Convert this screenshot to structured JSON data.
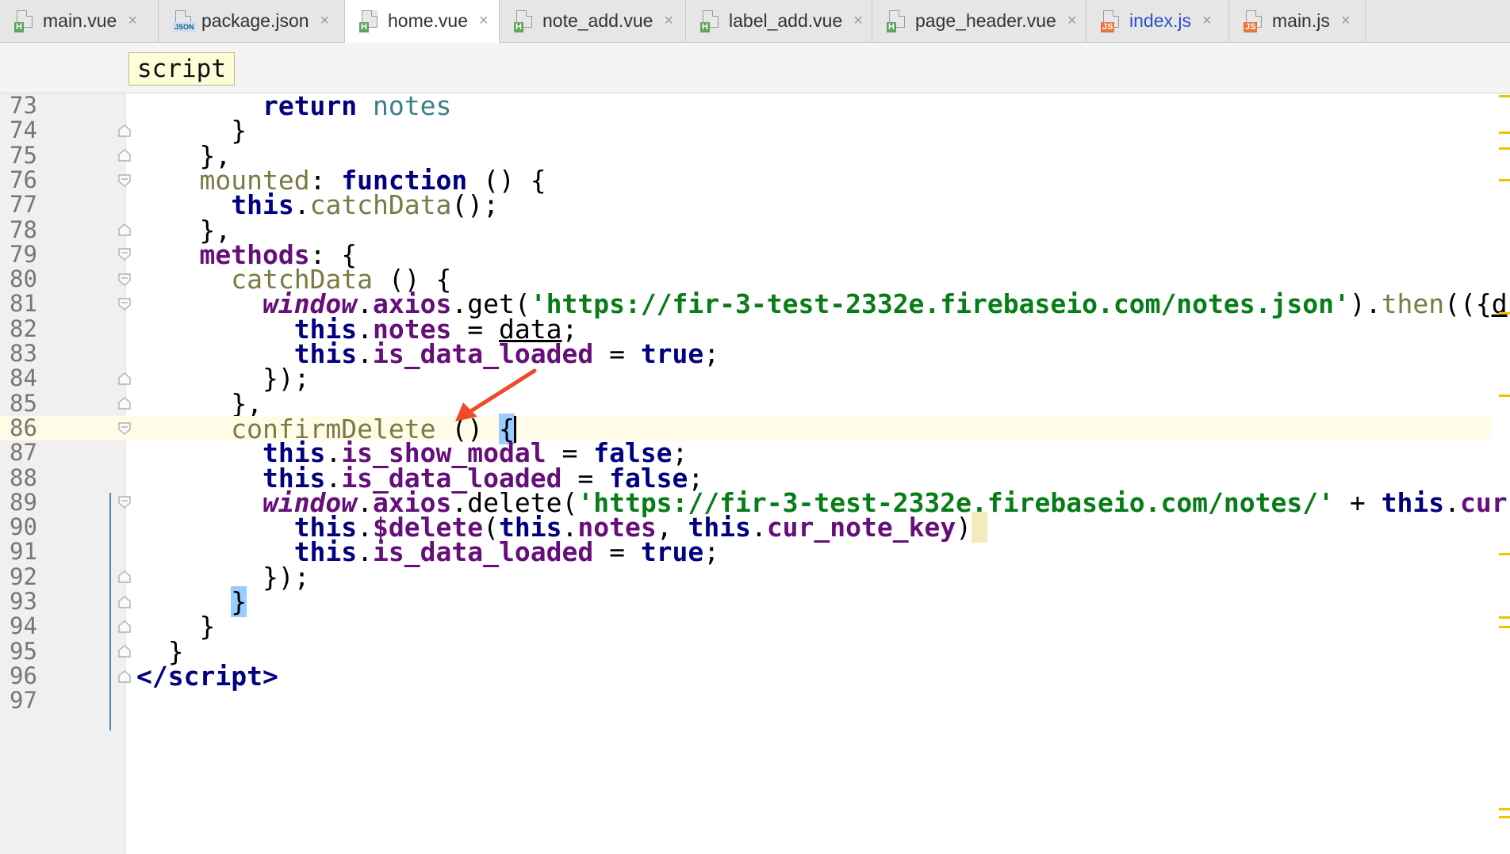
{
  "tabs": [
    {
      "label": "main.vue",
      "type": "vue",
      "badge": "H",
      "active": false
    },
    {
      "label": "package.json",
      "type": "json",
      "badge": "JSON",
      "active": false
    },
    {
      "label": "home.vue",
      "type": "vue",
      "badge": "H",
      "active": true
    },
    {
      "label": "note_add.vue",
      "type": "vue",
      "badge": "H",
      "active": false
    },
    {
      "label": "label_add.vue",
      "type": "vue",
      "badge": "H",
      "active": false
    },
    {
      "label": "page_header.vue",
      "type": "vue",
      "badge": "H",
      "active": false
    },
    {
      "label": "index.js",
      "type": "js",
      "badge": "JS",
      "active": false,
      "highlighted": true
    },
    {
      "label": "main.js",
      "type": "js",
      "badge": "JS",
      "active": false
    }
  ],
  "tab_close_glyph": "×",
  "breadcrumb": {
    "label": "script"
  },
  "editor": {
    "current_line": 86,
    "lines": [
      {
        "num": "73",
        "html": "        <span class=\"kw\">return</span> <span class=\"ref\">notes</span>"
      },
      {
        "num": "74",
        "html": "      }"
      },
      {
        "num": "75",
        "html": "    },"
      },
      {
        "num": "76",
        "html": "    <span class=\"fn\">mounted</span>: <span class=\"kw\">function</span> () {"
      },
      {
        "num": "77",
        "html": "      <span class=\"kw\">this</span>.<span class=\"fn\">catchData</span>();"
      },
      {
        "num": "78",
        "html": "    },"
      },
      {
        "num": "79",
        "html": "    <span class=\"prop\">methods</span>: {"
      },
      {
        "num": "80",
        "html": "      <span class=\"fn\">catchData</span> () {"
      },
      {
        "num": "81",
        "html": "        <span class=\"glob\">window</span>.<span class=\"prop\">axios</span>.get(<span class=\"str\">'https://fir-3-test-2332e.firebaseio.com/notes.json'</span>).<span class=\"fn\">then</span>(({<span class=\"ul\">d</span>"
      },
      {
        "num": "82",
        "html": "          <span class=\"kw\">this</span>.<span class=\"prop\">notes</span> = <span class=\"ul\">data</span>;"
      },
      {
        "num": "83",
        "html": "          <span class=\"kw\">this</span>.<span class=\"prop\">is_data_loaded</span> = <span class=\"kw\">true</span>;"
      },
      {
        "num": "84",
        "html": "        });"
      },
      {
        "num": "85",
        "html": "      },"
      },
      {
        "num": "86",
        "html": "      <span class=\"fn\">confirmDelete</span> () <span class=\"bm\">{</span><span class=\"caret\"></span>"
      },
      {
        "num": "87",
        "html": "        <span class=\"kw\">this</span>.<span class=\"prop\">is_show_modal</span> = <span class=\"kw\">false</span>;"
      },
      {
        "num": "88",
        "html": "        <span class=\"kw\">this</span>.<span class=\"prop\">is_data_loaded</span> = <span class=\"kw\">false</span>;"
      },
      {
        "num": "89",
        "html": "        <span class=\"glob\">window</span>.<span class=\"prop\">axios</span>.delete(<span class=\"str\">'https://fir-3-test-2332e.firebaseio.com/notes/'</span> + <span class=\"kw\">this</span>.<span class=\"prop\">cur</span>"
      },
      {
        "num": "90",
        "html": "          <span class=\"kw\">this</span>.<span class=\"prop\">$delete</span>(<span class=\"kw\">this</span>.<span class=\"prop\">notes</span>, <span class=\"kw\">this</span>.<span class=\"prop\">cur_note_key</span>)<span class=\"warn-hl\"> </span>"
      },
      {
        "num": "91",
        "html": "          <span class=\"kw\">this</span>.<span class=\"prop\">is_data_loaded</span> = <span class=\"kw\">true</span>;"
      },
      {
        "num": "92",
        "html": "        });"
      },
      {
        "num": "93",
        "html": "      <span class=\"bm\">}</span>"
      },
      {
        "num": "94",
        "html": "    }"
      },
      {
        "num": "95",
        "html": "  }"
      },
      {
        "num": "96",
        "html": "<span class=\"kw\">&lt;/script&gt;</span>"
      },
      {
        "num": "97",
        "html": ""
      }
    ]
  },
  "colors": {
    "keyword": "#000080",
    "property": "#660e7a",
    "string": "#067d17",
    "method": "#7a7a43",
    "current_line": "#fefbe6",
    "brace_match": "#99ccff",
    "annotation_arrow": "#f04a2a"
  }
}
